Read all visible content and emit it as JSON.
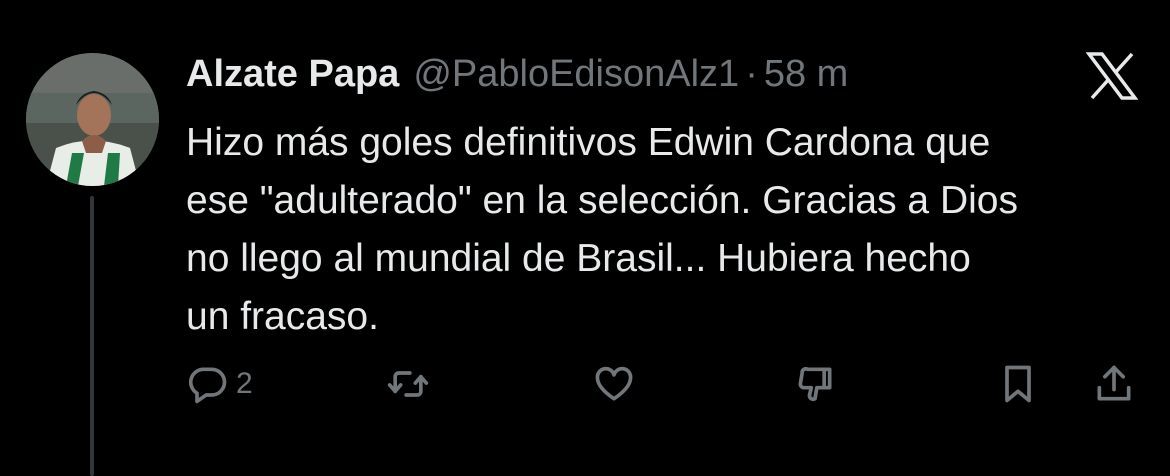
{
  "tweet": {
    "author_name": "Alzate Papa",
    "author_handle": "@PabloEdisonAlz1",
    "separator": "·",
    "timestamp": "58 m",
    "text": "Hizo más goles definitivos Edwin Cardona que\nese \"adulterado\" en la selección. Gracias a Dios\nno llego al  mundial de Brasil... Hubiera hecho\nun fracaso.",
    "avatar_icon": "avatar-player-photo",
    "platform_icon": "x-logo-icon"
  },
  "actions": {
    "reply": {
      "icon": "reply-icon",
      "count": "2"
    },
    "repost": {
      "icon": "repost-icon"
    },
    "like": {
      "icon": "heart-icon"
    },
    "dislike": {
      "icon": "downvote-icon"
    },
    "bookmark": {
      "icon": "bookmark-icon"
    },
    "share": {
      "icon": "share-icon"
    }
  },
  "colors": {
    "background": "#000000",
    "primary_text": "#e7e9ea",
    "secondary_text": "#71767b",
    "thread_line": "#333639"
  }
}
